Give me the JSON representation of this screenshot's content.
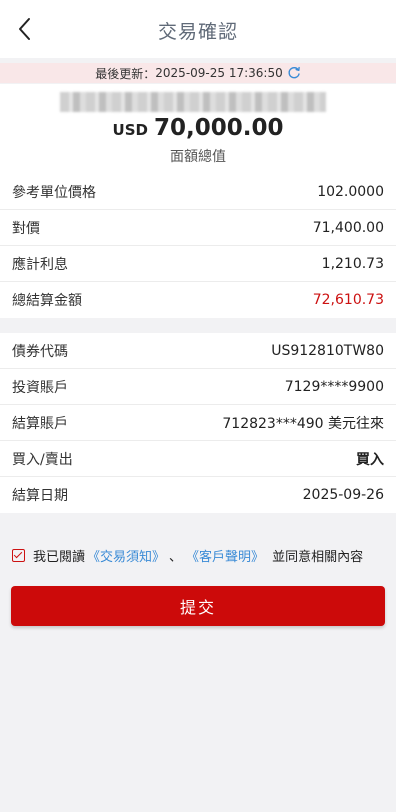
{
  "header": {
    "title": "交易確認",
    "back_icon": "chevron-left-icon"
  },
  "update": {
    "label": "最後更新：",
    "timestamp": "2025-09-25 17:36:50",
    "refresh_icon": "refresh-icon",
    "refresh_color": "#3a8bd6"
  },
  "summary": {
    "currency": "USD",
    "amount": "70,000.00",
    "amount_label": "面額總值"
  },
  "price_rows": [
    {
      "label": "參考單位價格",
      "value": "102.0000"
    },
    {
      "label": "對價",
      "value": "71,400.00"
    },
    {
      "label": "應計利息",
      "value": "1,210.73"
    },
    {
      "label": "總結算金額",
      "value": "72,610.73",
      "value_color": "#cc1111"
    }
  ],
  "account_rows": [
    {
      "label": "債券代碼",
      "value": "US912810TW80"
    },
    {
      "label": "投資賬戶",
      "value": "7129****9900"
    },
    {
      "label": "結算賬戶",
      "value": "712823***490 美元往來"
    },
    {
      "label": "買入/賣出",
      "value": "買入"
    },
    {
      "label": "結算日期",
      "value": "2025-09-26"
    }
  ],
  "agreement": {
    "checked": true,
    "prefix": "我已閱讀",
    "link1": "《交易須知》",
    "separator": "、",
    "link2": "《客戶聲明》",
    "suffix": "並同意相關內容"
  },
  "submit_label": "提交",
  "colors": {
    "accent_red": "#cc0a0a",
    "link_blue": "#3a8bd6",
    "update_bar_bg": "#f9e7e8"
  }
}
